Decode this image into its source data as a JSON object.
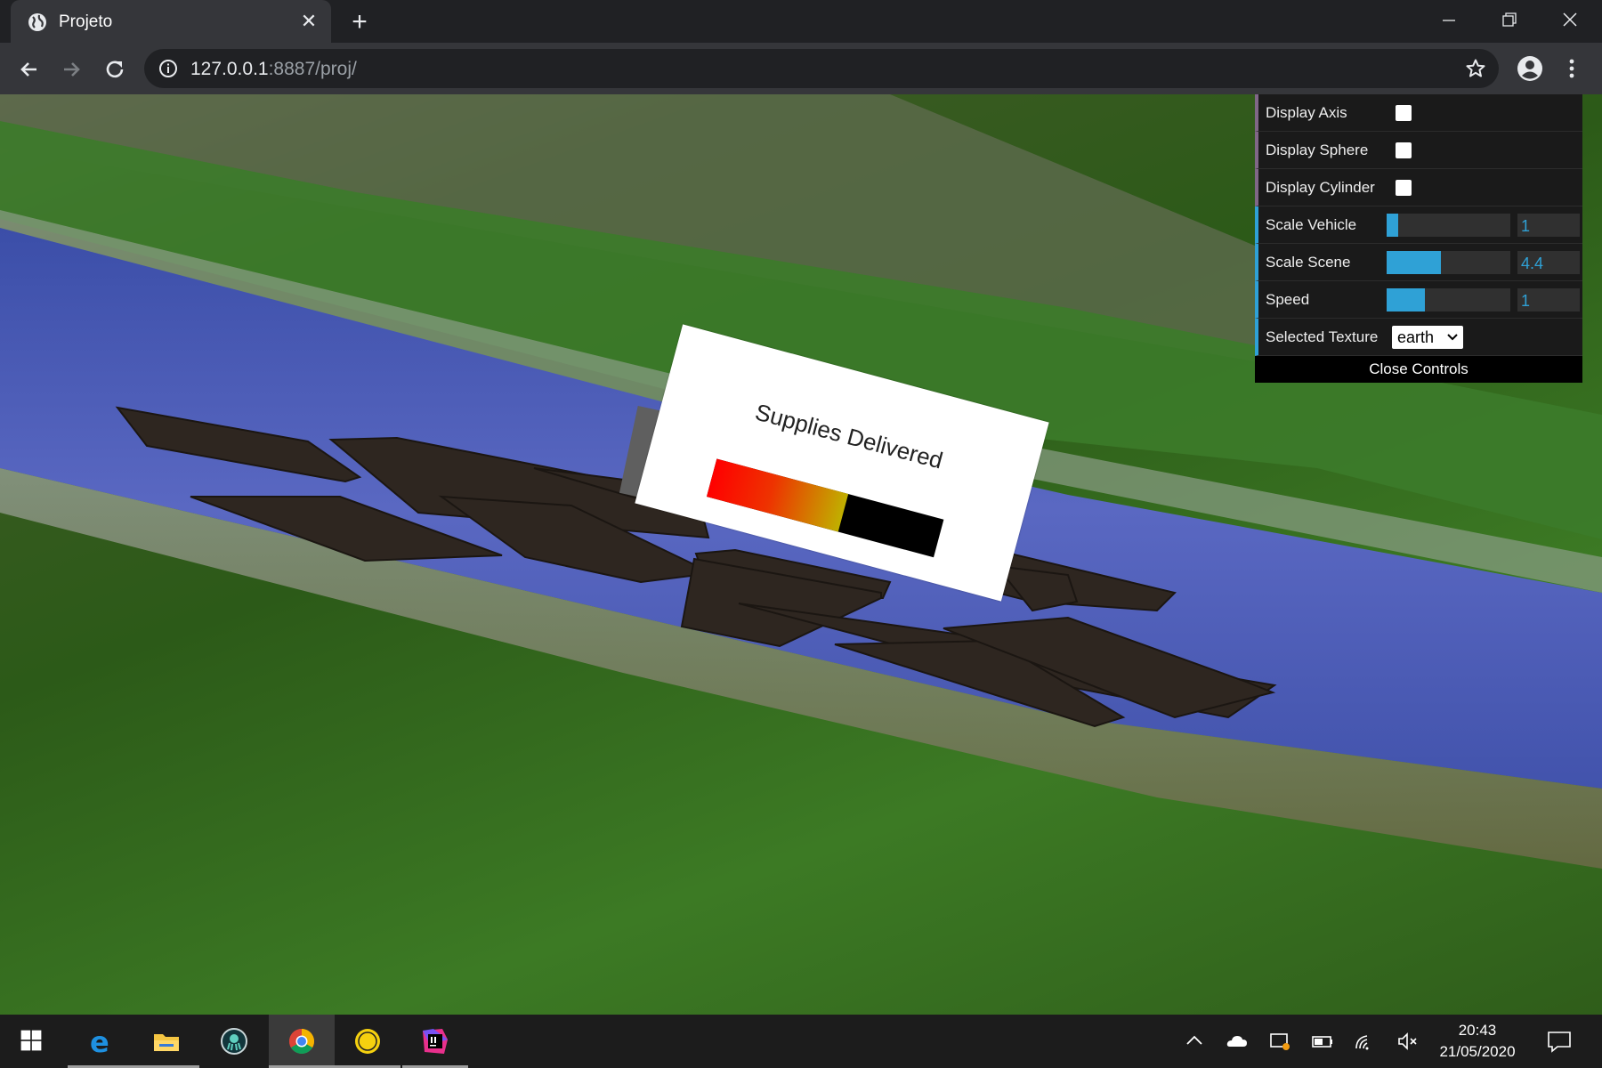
{
  "browser": {
    "tab_title": "Projeto",
    "url_host": "127.0.0.1",
    "url_rest": ":8887/proj/"
  },
  "scene": {
    "sign_text": "Supplies Delivered",
    "progress_fraction": 0.58
  },
  "gui": {
    "display_axis_label": "Display Axis",
    "display_axis_checked": false,
    "display_sphere_label": "Display Sphere",
    "display_sphere_checked": false,
    "display_cylinder_label": "Display Cylinder",
    "display_cylinder_checked": false,
    "scale_vehicle_label": "Scale Vehicle",
    "scale_vehicle_value": "1",
    "scale_vehicle_fraction": 0.09,
    "scale_scene_label": "Scale Scene",
    "scale_scene_value": "4.4",
    "scale_scene_fraction": 0.44,
    "speed_label": "Speed",
    "speed_value": "1",
    "speed_fraction": 0.31,
    "selected_texture_label": "Selected Texture",
    "selected_texture_value": "earth",
    "close_controls_label": "Close Controls"
  },
  "taskbar": {
    "time": "20:43",
    "date": "21/05/2020"
  },
  "colors": {
    "gui_accent": "#2fa1d6",
    "gui_bool_accent": "#806787",
    "browser_dark": "#202124",
    "browser_tab": "#35363a"
  }
}
